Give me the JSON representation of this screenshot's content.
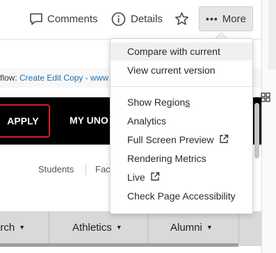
{
  "toolbar": {
    "comments_label": "Comments",
    "details_label": "Details",
    "more_label": "More",
    "more_dots": "•••"
  },
  "workflow": {
    "prefix": "flow: ",
    "link_text": "Create Edit Copy - www"
  },
  "site": {
    "apply_label": "APPLY",
    "myuno_label": "MY UNO",
    "audience": [
      "Students",
      "Fac"
    ],
    "tabs": [
      "arch",
      "Athletics",
      "Alumni"
    ]
  },
  "menu": {
    "items": [
      {
        "label": "Compare with current",
        "highlighted": true
      },
      {
        "label": "View current version"
      },
      {
        "label": "Show Region",
        "label_tail": "s"
      },
      {
        "label": "Analytics"
      },
      {
        "label": "Full Screen Preview",
        "icon": "external-link-icon"
      },
      {
        "label": "Rendering Metrics"
      },
      {
        "label": "Live",
        "icon": "external-link-icon"
      },
      {
        "label": "Check Page Accessibility"
      }
    ]
  },
  "colors": {
    "site_nav": "#000000",
    "apply_border": "#d41f26",
    "link": "#1f6fb0",
    "more_bg": "#e6e6e6"
  }
}
